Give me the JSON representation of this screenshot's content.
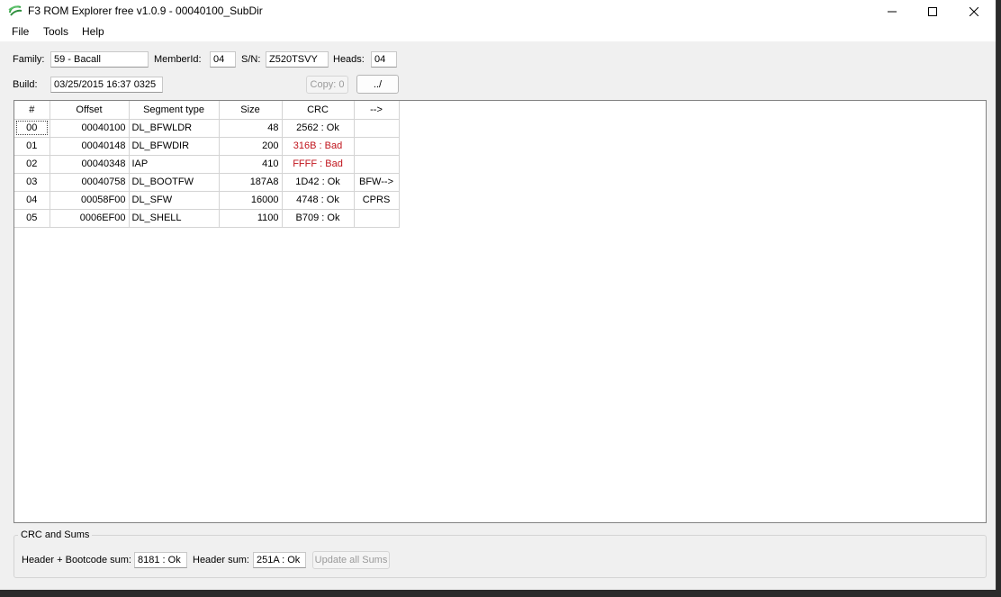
{
  "window": {
    "title": "F3 ROM Explorer free v1.0.9 - 00040100_SubDir",
    "icon": "seagate-logo-icon"
  },
  "menu": [
    "File",
    "Tools",
    "Help"
  ],
  "info": {
    "family_label": "Family:",
    "family_value": "59 - Bacall",
    "memberid_label": "MemberId:",
    "memberid_value": "04",
    "sn_label": "S/N:",
    "sn_value": "Z520TSVY",
    "heads_label": "Heads:",
    "heads_value": "04",
    "build_label": "Build:",
    "build_value": "03/25/2015 16:37 0325",
    "copy_button": "Copy: 0",
    "up_button": "../"
  },
  "table": {
    "columns": [
      "#",
      "Offset",
      "Segment type",
      "Size",
      "CRC",
      "-->"
    ],
    "rows": [
      {
        "num": "00",
        "offset": "00040100",
        "type": "DL_BFWLDR",
        "size": "48",
        "crc": "2562 : Ok",
        "link": ""
      },
      {
        "num": "01",
        "offset": "00040148",
        "type": "DL_BFWDIR",
        "size": "200",
        "crc": "316B : Bad",
        "link": ""
      },
      {
        "num": "02",
        "offset": "00040348",
        "type": "IAP",
        "size": "410",
        "crc": "FFFF : Bad",
        "link": ""
      },
      {
        "num": "03",
        "offset": "00040758",
        "type": "DL_BOOTFW",
        "size": "187A8",
        "crc": "1D42 : Ok",
        "link": "BFW-->"
      },
      {
        "num": "04",
        "offset": "00058F00",
        "type": "DL_SFW",
        "size": "16000",
        "crc": "4748 : Ok",
        "link": "CPRS"
      },
      {
        "num": "05",
        "offset": "0006EF00",
        "type": "DL_SHELL",
        "size": "1100",
        "crc": "B709 : Ok",
        "link": ""
      }
    ]
  },
  "sums": {
    "group_title": "CRC and Sums",
    "header_boot_label": "Header + Bootcode sum:",
    "header_boot_value": "8181 : Ok",
    "header_label": "Header sum:",
    "header_value": "251A : Ok",
    "update_button": "Update all Sums"
  },
  "colors": {
    "bad": "#c0141c",
    "window_bg": "#f0f0f0",
    "titlebar": "#ffffff"
  }
}
